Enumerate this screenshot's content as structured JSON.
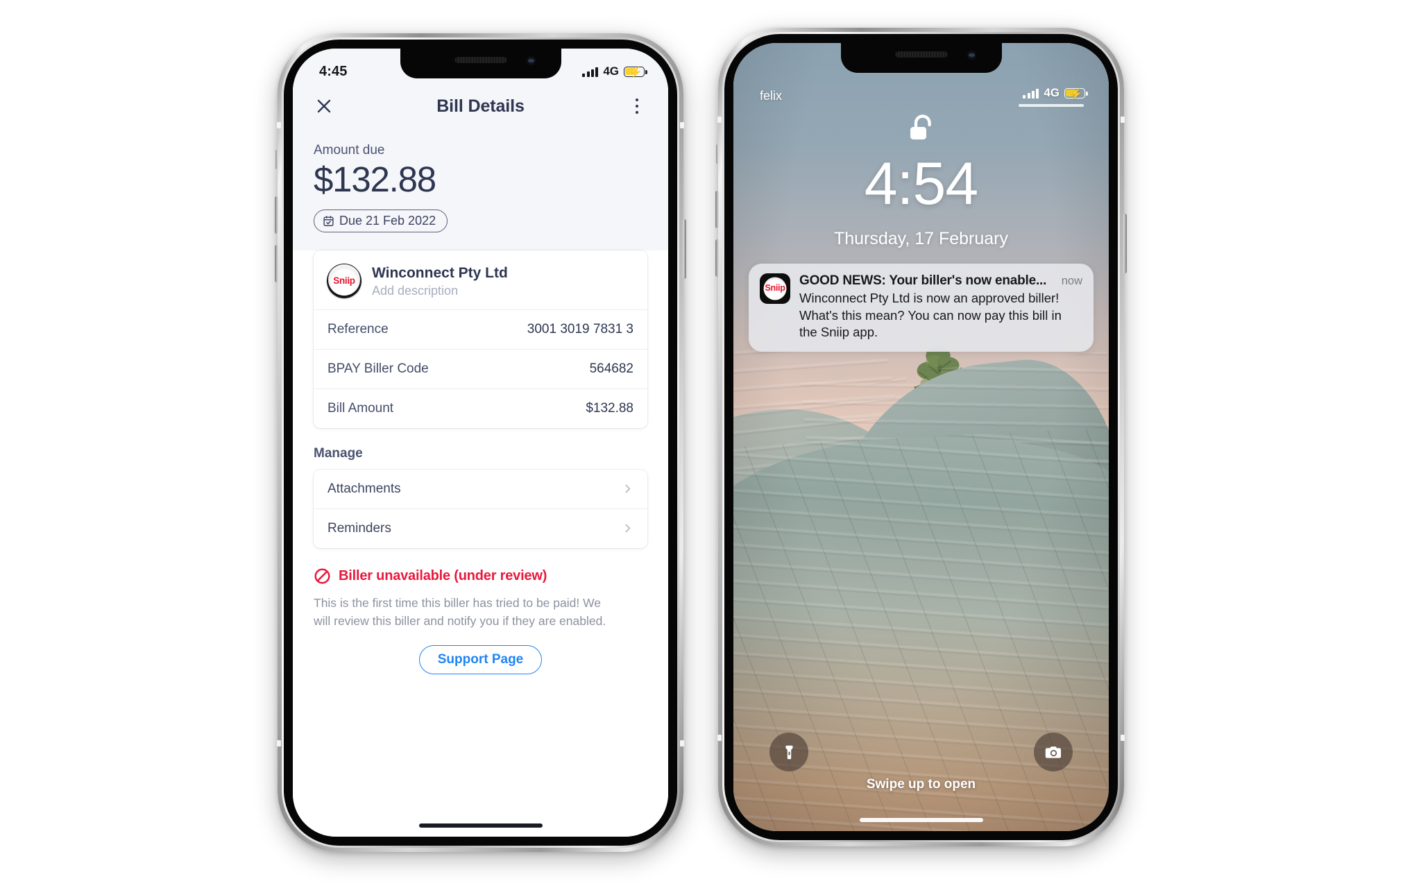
{
  "left_phone": {
    "status_bar": {
      "time": "4:45",
      "network": "4G",
      "signal_icon": "cellular-bars-icon",
      "battery_icon": "battery-charging-icon"
    },
    "navbar": {
      "close_icon": "close-icon",
      "title": "Bill Details",
      "more_icon": "more-vertical-icon"
    },
    "hero": {
      "amount_label": "Amount due",
      "amount": "$132.88",
      "due_chip": "Due 21 Feb 2022",
      "calendar_icon": "calendar-check-icon"
    },
    "biller": {
      "logo_text": "Sniip",
      "name": "Winconnect Pty Ltd",
      "description_placeholder": "Add description"
    },
    "details": [
      {
        "label": "Reference",
        "value": "3001 3019 7831 3"
      },
      {
        "label": "BPAY Biller Code",
        "value": "564682"
      },
      {
        "label": "Bill Amount",
        "value": "$132.88"
      }
    ],
    "manage": {
      "section_title": "Manage",
      "items": [
        {
          "label": "Attachments",
          "chevron_icon": "chevron-right-icon"
        },
        {
          "label": "Reminders",
          "chevron_icon": "chevron-right-icon"
        }
      ]
    },
    "alert": {
      "icon": "no-entry-icon",
      "title": "Biller unavailable (under review)",
      "body": "This is the first time this biller has tried to be paid! We will review this biller and notify you if they are enabled.",
      "button_label": "Support Page",
      "title_color": "#e8193c",
      "button_color": "#1e85f2"
    }
  },
  "right_phone": {
    "status_bar": {
      "carrier": "felix",
      "network": "4G",
      "signal_icon": "cellular-bars-icon",
      "battery_icon": "battery-charging-icon"
    },
    "lock": {
      "lock_icon": "unlocked-padlock-icon",
      "time": "4:54",
      "date": "Thursday, 17 February"
    },
    "notification": {
      "app_icon_text": "Sniip",
      "title": "GOOD NEWS: Your biller's now enable...",
      "timestamp": "now",
      "body": "Winconnect Pty Ltd is now an approved biller! What's this mean? You can now pay this bill in the Sniip app."
    },
    "actions": {
      "flashlight_icon": "flashlight-icon",
      "camera_icon": "camera-icon",
      "swipe_hint": "Swipe up to open"
    }
  }
}
